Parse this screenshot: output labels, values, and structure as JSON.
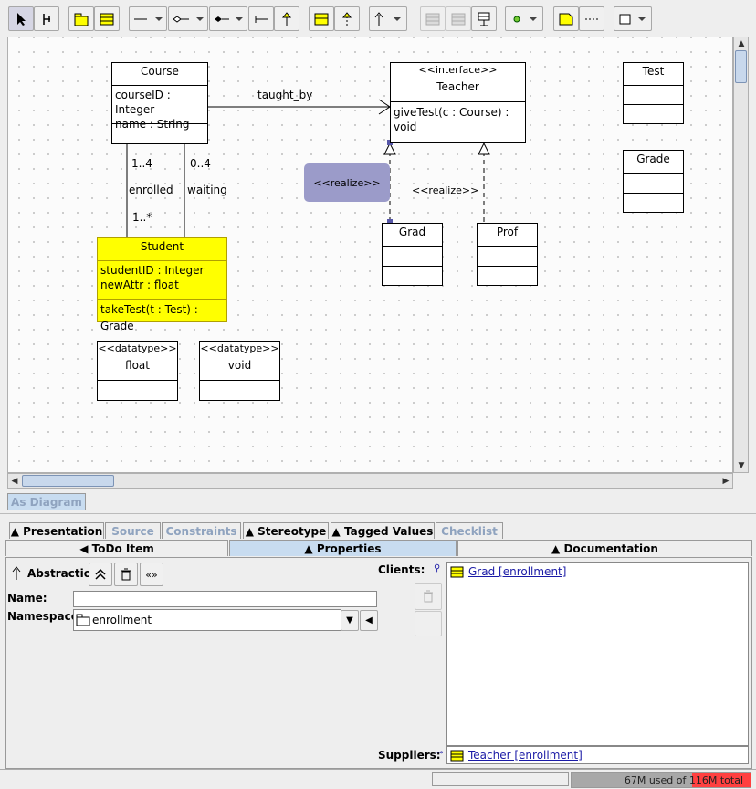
{
  "toolbar": {
    "buttons": [
      {
        "icon": "select-arrow-icon"
      },
      {
        "icon": "broom-icon"
      },
      {
        "icon": "package-icon"
      },
      {
        "icon": "class-icon"
      },
      {
        "icon": "association-icon"
      },
      {
        "icon": "aggregation-icon"
      },
      {
        "icon": "composition-icon"
      },
      {
        "icon": "dependency-icon"
      },
      {
        "icon": "generalization-icon"
      },
      {
        "icon": "interface-icon"
      },
      {
        "icon": "realization-icon"
      },
      {
        "icon": "abstraction-icon"
      },
      {
        "icon": "add-attribute-icon"
      },
      {
        "icon": "add-operation-icon"
      },
      {
        "icon": "signal-icon"
      },
      {
        "icon": "point-icon"
      },
      {
        "icon": "note-icon"
      },
      {
        "icon": "dotted-line-icon"
      },
      {
        "icon": "rectangle-icon"
      }
    ]
  },
  "diagram": {
    "classes": {
      "course": {
        "name": "Course",
        "attrs": [
          "courseID : Integer",
          "name : String"
        ]
      },
      "teacher": {
        "stereotype": "<<interface>>",
        "name": "Teacher",
        "ops": [
          "giveTest(c : Course) : void"
        ]
      },
      "test": {
        "name": "Test"
      },
      "grade": {
        "name": "Grade"
      },
      "student": {
        "name": "Student",
        "attrs": [
          "studentID : Integer",
          "newAttr : float"
        ],
        "ops": [
          "takeTest(t : Test) : Grade"
        ]
      },
      "grad": {
        "name": "Grad"
      },
      "prof": {
        "name": "Prof"
      },
      "float_type": {
        "stereotype": "<<datatype>>",
        "name": "float"
      },
      "void_type": {
        "stereotype": "<<datatype>>",
        "name": "void"
      }
    },
    "labels": {
      "taught_by": "taught_by",
      "mult_1_4": "1..4",
      "mult_0_4": "0..4",
      "enrolled": "enrolled",
      "waiting": "waiting",
      "mult_1_star": "1..*",
      "realize_selected": "<<realize>>",
      "realize": "<<realize>>"
    }
  },
  "view_tab": "As Diagram",
  "tabs_row1": [
    "Presentation",
    "Source",
    "Constraints",
    "Stereotype",
    "Tagged Values",
    "Checklist"
  ],
  "tabs_row2": [
    "ToDo Item",
    "Properties",
    "Documentation"
  ],
  "properties": {
    "type_label": "Abstraction",
    "name_label": "Name:",
    "name_value": "",
    "namespace_label": "Namespace:",
    "namespace_value": "enrollment",
    "clients_label": "Clients:",
    "clients": [
      "Grad [enrollment]"
    ],
    "suppliers_label": "Suppliers:",
    "suppliers": [
      "Teacher [enrollment]"
    ]
  },
  "status": {
    "memory": "67M used of 116M total",
    "memory_fraction": 0.58
  }
}
